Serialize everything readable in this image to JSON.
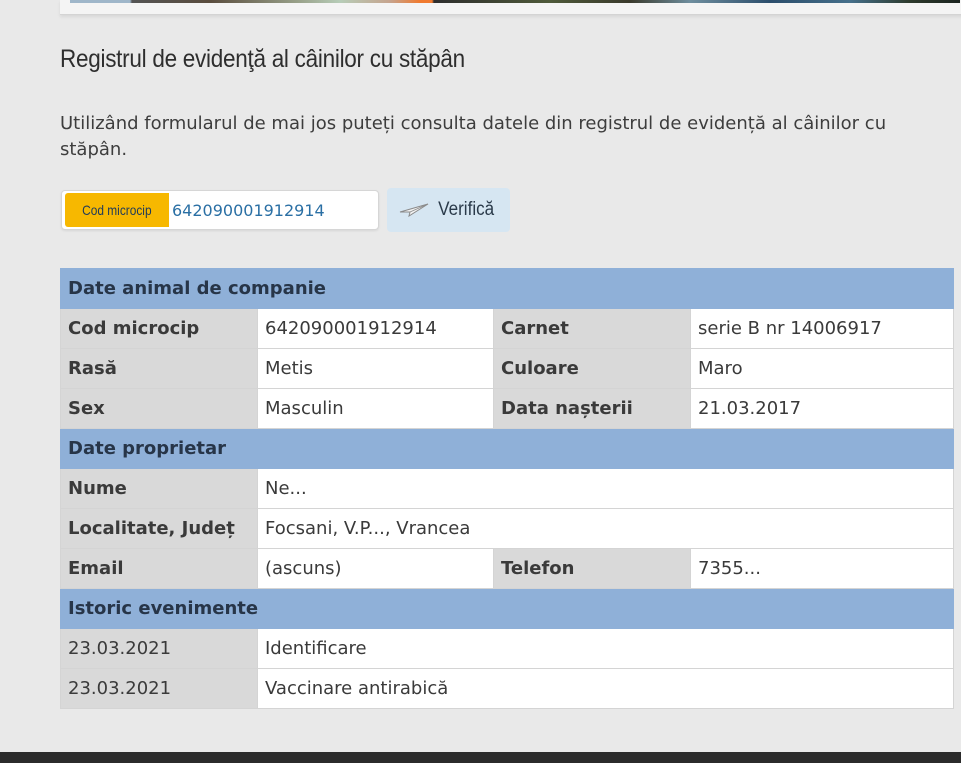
{
  "page": {
    "title": "Registrul de evidenţă al câinilor cu stăpân",
    "intro": "Utilizând formularul de mai jos puteți consulta datele din registrul de evidență al câinilor cu stăpân."
  },
  "search": {
    "label": "Cod microcip",
    "value": "642090001912914",
    "button_label": "Verifică",
    "button_icon": "paper-plane-icon"
  },
  "pet": {
    "heading": "Date animal de companie",
    "microchip_label": "Cod microcip",
    "microchip_value": "642090001912914",
    "carnet_label": "Carnet",
    "carnet_value": "serie B nr 14006917",
    "breed_label": "Rasă",
    "breed_value": "Metis",
    "color_label": "Culoare",
    "color_value": "Maro",
    "sex_label": "Sex",
    "sex_value": "Masculin",
    "birth_label": "Data nașterii",
    "birth_value": "21.03.2017"
  },
  "owner": {
    "heading": "Date proprietar",
    "name_label": "Nume",
    "name_value": "Ne...",
    "locality_label": "Localitate, Județ",
    "locality_value": "Focsani, V.P..., Vrancea",
    "email_label": "Email",
    "email_value": "(ascuns)",
    "phone_label": "Telefon",
    "phone_value": "7355..."
  },
  "events": {
    "heading": "Istoric evenimente",
    "items": [
      {
        "date": "23.03.2021",
        "event": "Identificare"
      },
      {
        "date": "23.03.2021",
        "event": "Vaccinare antirabică"
      }
    ]
  },
  "colors": {
    "section_header": "#8fb0d8",
    "label_cell": "#d9d9d9",
    "search_label": "#f7b800",
    "button": "#d6e6f2",
    "footer": "#2b2b2b"
  }
}
